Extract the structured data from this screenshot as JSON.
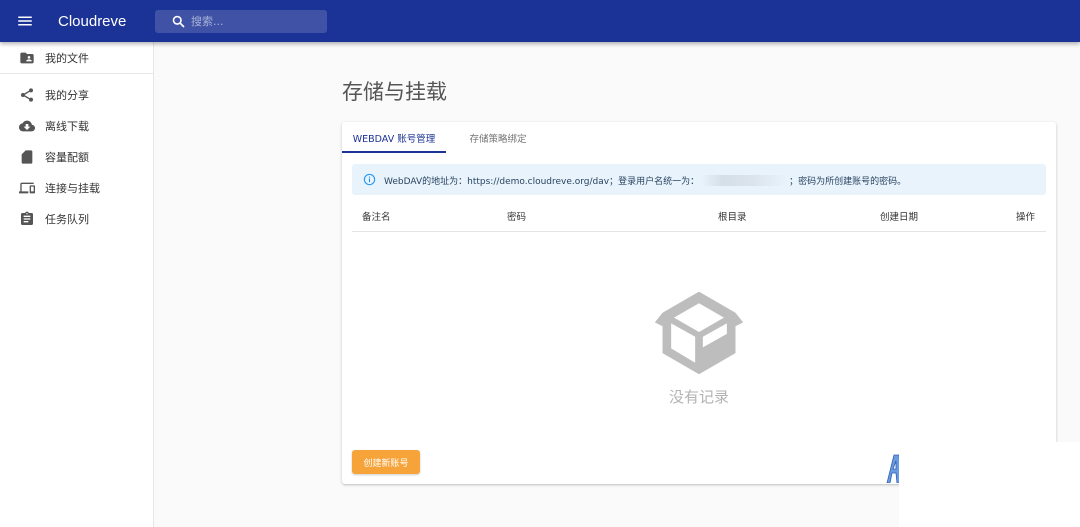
{
  "header": {
    "app_title": "Cloudreve",
    "search_placeholder": "搜索...",
    "bar_color": "#1b3296"
  },
  "sidebar": {
    "items": [
      {
        "label": "我的文件",
        "icon": "folder-user-icon"
      },
      {
        "label": "我的分享",
        "icon": "share-icon"
      },
      {
        "label": "离线下载",
        "icon": "cloud-download-icon"
      },
      {
        "label": "容量配额",
        "icon": "sd-card-icon"
      },
      {
        "label": "连接与挂载",
        "icon": "devices-icon"
      },
      {
        "label": "任务队列",
        "icon": "clipboard-list-icon"
      }
    ]
  },
  "main": {
    "page_title": "存储与挂载",
    "tabs": [
      {
        "label": "WEBDAV 账号管理",
        "active": true
      },
      {
        "label": "存储策略绑定",
        "active": false
      }
    ],
    "alert": {
      "icon": "info-icon",
      "text_before": "WebDAV的地址为：https://demo.cloudreve.org/dav；登录用户名统一为：",
      "text_after": "；密码为所创建账号的密码。"
    },
    "table": {
      "columns": [
        "备注名",
        "密码",
        "根目录",
        "创建日期",
        "操作"
      ]
    },
    "empty": {
      "icon": "empty-box-icon",
      "text": "没有记录"
    },
    "create_button": "创建新账号",
    "accent_color": "#f6a43a"
  }
}
